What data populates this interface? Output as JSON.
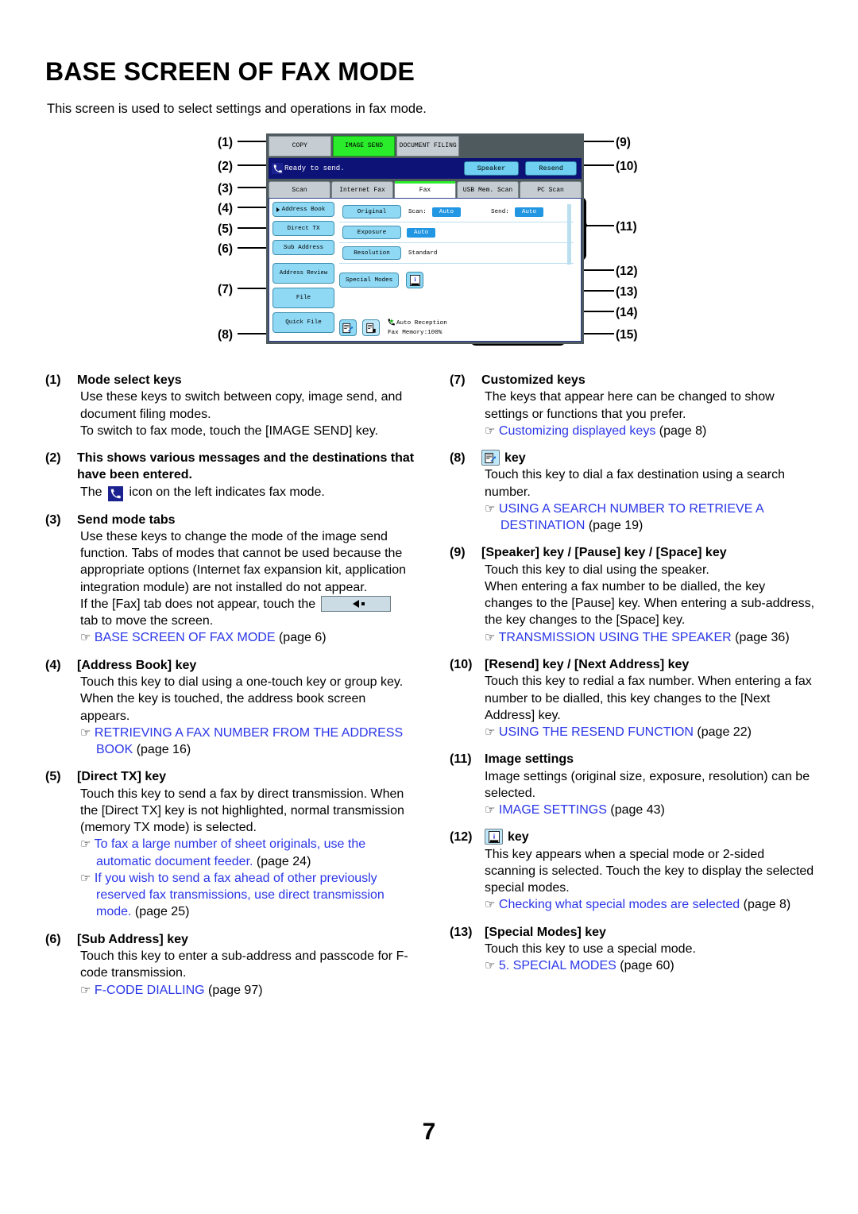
{
  "page": {
    "title": "BASE SCREEN OF FAX MODE",
    "intro": "This screen is used to select settings and operations in fax mode.",
    "page_number": "7"
  },
  "figure": {
    "callouts_left": [
      "(1)",
      "(2)",
      "(3)",
      "(4)",
      "(5)",
      "(6)",
      "(7)",
      "(8)"
    ],
    "callouts_right": [
      "(9)",
      "(10)",
      "(11)",
      "(12)",
      "(13)",
      "(14)",
      "(15)"
    ],
    "panel": {
      "mode_keys": [
        {
          "label": "COPY",
          "active": false
        },
        {
          "label": "IMAGE SEND",
          "active": true
        },
        {
          "label": "DOCUMENT FILING",
          "active": false
        }
      ],
      "message_bar": {
        "status_text": "Ready to send.",
        "fax_mode_icon": "phone-handset-icon",
        "speaker_key": "Speaker",
        "resend_key": "Resend"
      },
      "send_mode_tabs": [
        {
          "label": "Scan",
          "selected": false
        },
        {
          "label": "Internet Fax",
          "selected": false
        },
        {
          "label": "Fax",
          "selected": true
        },
        {
          "label": "USB Mem. Scan",
          "selected": false
        },
        {
          "label": "PC Scan",
          "selected": false
        }
      ],
      "left_keys": [
        "Address Book",
        "Direct TX",
        "Sub Address"
      ],
      "customized_keys": [
        "Address Review",
        "File",
        "Quick File"
      ],
      "image_settings": [
        {
          "button": "Original",
          "label1": "Scan:",
          "value1": "Auto",
          "label2": "Send:",
          "value2": "Auto"
        },
        {
          "button": "Exposure",
          "value1": "Auto"
        },
        {
          "button": "Resolution",
          "plain": "Standard"
        }
      ],
      "special_modes_key": "Special Modes",
      "info_key_icon": "info-key-icon",
      "search_number_key_icon": "search-number-key-icon",
      "two_sided_key_icon": "two-sided-scan-icon",
      "status": {
        "reception_icon": "auto-reception-icon",
        "reception_text": "Auto Reception",
        "memory_text": "Fax Memory:100%"
      }
    }
  },
  "descriptions": {
    "left": [
      {
        "num": "(1)",
        "title": "Mode select keys",
        "lines": [
          "Use these keys to switch between copy, image send, and document filing modes.",
          "To switch to fax mode, touch the [IMAGE SEND] key."
        ]
      },
      {
        "num": "(2)",
        "title": "This shows various messages and the destinations that have been entered.",
        "line_before_icon": "The",
        "icon": "phone-handset-icon",
        "line_after_icon": "icon on the left indicates fax mode."
      },
      {
        "num": "(3)",
        "title": "Send mode tabs",
        "lines": [
          "Use these keys to change the mode of the image send function. Tabs of modes that cannot be used because the appropriate options (Internet fax expansion kit, application integration module) are not installed do not appear."
        ],
        "tab_line_before": "If the [Fax] tab does not appear, touch the",
        "tab_button_icon": "left-arrow-tab-button",
        "tab_line_after": "tab to move the screen.",
        "refs": [
          {
            "text": "BASE SCREEN OF FAX MODE",
            "page": "(page 6)"
          }
        ]
      },
      {
        "num": "(4)",
        "title": "[Address Book] key",
        "lines": [
          "Touch this key to dial using a one-touch key or group key. When the key is touched, the address book screen appears."
        ],
        "refs": [
          {
            "text": "RETRIEVING A FAX NUMBER FROM THE ADDRESS BOOK",
            "page": "(page 16)"
          }
        ]
      },
      {
        "num": "(5)",
        "title": "[Direct TX] key",
        "lines": [
          "Touch this key to send a fax by direct transmission. When the [Direct TX] key is not highlighted, normal transmission (memory TX mode) is selected."
        ],
        "refs": [
          {
            "text": "To fax a large number of sheet originals, use the automatic document feeder.",
            "page": "(page 24)"
          },
          {
            "text": "If you wish to send a fax ahead of other previously reserved fax transmissions, use direct transmission mode.",
            "page": "(page 25)"
          }
        ]
      },
      {
        "num": "(6)",
        "title": "[Sub Address] key",
        "lines": [
          "Touch this key to enter a sub-address and passcode for F-code transmission."
        ],
        "refs": [
          {
            "text": "F-CODE DIALLING",
            "page": "(page 97)"
          }
        ]
      }
    ],
    "right": [
      {
        "num": "(7)",
        "title": "Customized keys",
        "lines": [
          "The keys that appear here can be changed to show settings or functions that you prefer."
        ],
        "refs": [
          {
            "text": "Customizing displayed keys",
            "page": "(page 8)"
          }
        ]
      },
      {
        "num": "(8)",
        "icon": "search-number-key-icon",
        "title": "key",
        "lines": [
          "Touch this key to dial a fax destination using a search number."
        ],
        "refs": [
          {
            "text": "USING A SEARCH NUMBER TO RETRIEVE A DESTINATION",
            "page": "(page 19)"
          }
        ]
      },
      {
        "num": "(9)",
        "title": "[Speaker] key / [Pause] key / [Space] key",
        "lines": [
          "Touch this key to dial using the speaker.",
          "When entering a fax number to be dialled, the key changes to the [Pause] key. When entering a sub-address, the key changes to the [Space] key."
        ],
        "refs": [
          {
            "text": "TRANSMISSION USING THE SPEAKER",
            "page": "(page 36)"
          }
        ]
      },
      {
        "num": "(10)",
        "title": "[Resend] key / [Next Address] key",
        "lines": [
          "Touch this key to redial a fax number. When entering a fax number to be dialled, this key changes to the [Next Address] key."
        ],
        "refs": [
          {
            "text": "USING THE RESEND FUNCTION",
            "page": "(page 22)"
          }
        ]
      },
      {
        "num": "(11)",
        "title": "Image settings",
        "lines": [
          "Image settings (original size, exposure, resolution) can be selected."
        ],
        "refs": [
          {
            "text": "IMAGE SETTINGS",
            "page": "(page 43)"
          }
        ]
      },
      {
        "num": "(12)",
        "icon": "info-key-icon",
        "title": "key",
        "lines": [
          "This key appears when a special mode or 2-sided scanning is selected. Touch the key to display the selected special modes."
        ],
        "refs": [
          {
            "text": "Checking what special modes are selected",
            "page": "(page 8)"
          }
        ]
      },
      {
        "num": "(13)",
        "title": "[Special Modes] key",
        "lines": [
          "Touch this key to use a special mode."
        ],
        "refs": [
          {
            "text": "5. SPECIAL MODES",
            "page": "(page 60)"
          }
        ]
      }
    ]
  },
  "colors": {
    "link": "#2a36e8",
    "panel_bg": "#4e5a5e",
    "message_bar": "#0d1277",
    "key_blue": "#8fd9f5",
    "value_blue": "#2196e3",
    "active_green": "#2bec2b"
  }
}
